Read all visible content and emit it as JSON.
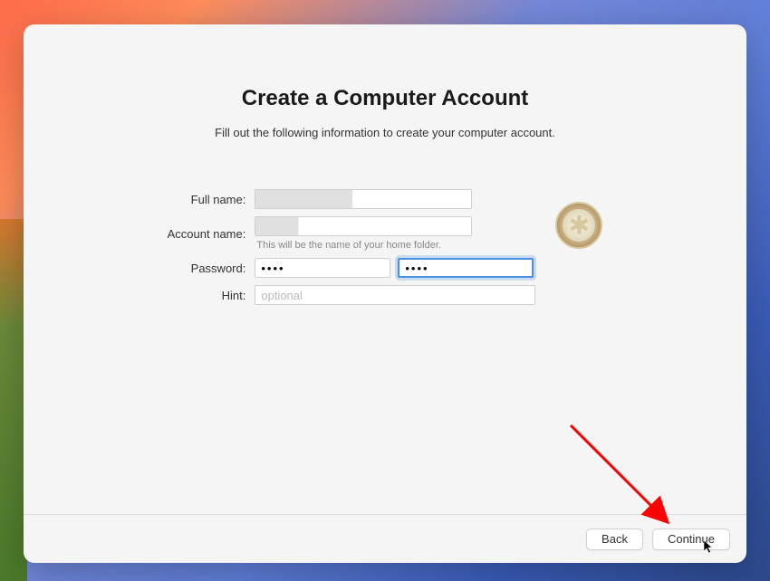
{
  "header": {
    "title": "Create a Computer Account",
    "subtitle": "Fill out the following information to create your computer account."
  },
  "form": {
    "full_name": {
      "label": "Full name:",
      "value": ""
    },
    "account_name": {
      "label": "Account name:",
      "value": "",
      "helper": "This will be the name of your home folder."
    },
    "password": {
      "label": "Password:",
      "value": "••••",
      "verify_value": "••••"
    },
    "hint": {
      "label": "Hint:",
      "value": "",
      "placeholder": "optional"
    }
  },
  "footer": {
    "back_label": "Back",
    "continue_label": "Continue"
  }
}
